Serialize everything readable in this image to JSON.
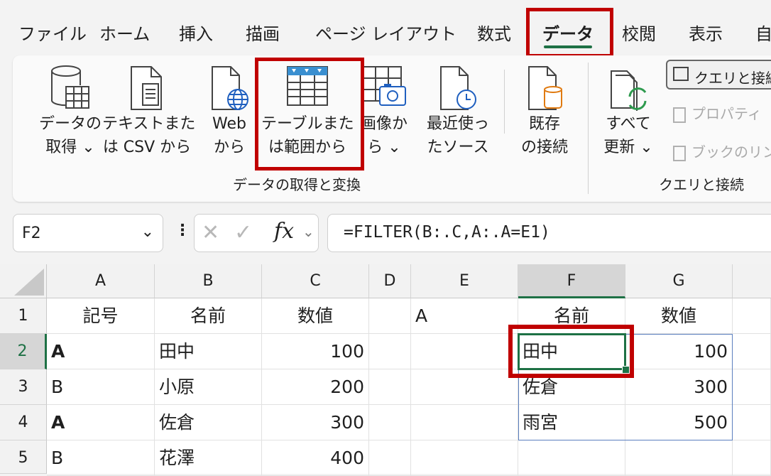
{
  "tabs": [
    "ファイル",
    "ホーム",
    "挿入",
    "描画",
    "ページ レイアウト",
    "数式",
    "データ",
    "校閲",
    "表示",
    "自"
  ],
  "active_tab": "データ",
  "ribbon": {
    "get_data": {
      "l1": "データの",
      "l2": "取得 ⌄"
    },
    "text_csv": {
      "l1": "テキストまた",
      "l2": "は CSV から"
    },
    "web": {
      "l1": "Web",
      "l2": "から"
    },
    "table_range": {
      "l1": "テーブルまた",
      "l2": "は範囲から"
    },
    "image": {
      "l1": "画像か",
      "l2": "ら ⌄"
    },
    "recent": {
      "l1": "最近使っ",
      "l2": "たソース"
    },
    "existing": {
      "l1": "既存",
      "l2": "の接続"
    },
    "group1_label": "データの取得と変換",
    "refresh_all": {
      "l1": "すべて",
      "l2": "更新 ⌄"
    },
    "queries": "クエリと接続",
    "properties": "プロパティ",
    "workbook_links": "ブックのリン",
    "group2_label": "クエリと接続"
  },
  "formula_bar": {
    "name_box": "F2",
    "fx": "fx",
    "formula": "=FILTER(B:.C,A:.A=E1)"
  },
  "sheet": {
    "columns": [
      "A",
      "B",
      "C",
      "D",
      "E",
      "F",
      "G"
    ],
    "selected_column": "F",
    "selected_row": "2",
    "rows": [
      {
        "n": "1",
        "A": "記号",
        "B": "名前",
        "C": "数値",
        "D": "",
        "E": "A",
        "F": "名前",
        "G": "数値"
      },
      {
        "n": "2",
        "A": "A",
        "B": "田中",
        "C": "100",
        "D": "",
        "E": "",
        "F": "田中",
        "G": "100"
      },
      {
        "n": "3",
        "A": "B",
        "B": "小原",
        "C": "200",
        "D": "",
        "E": "",
        "F": "佐倉",
        "G": "300"
      },
      {
        "n": "4",
        "A": "A",
        "B": "佐倉",
        "C": "300",
        "D": "",
        "E": "",
        "F": "雨宮",
        "G": "500"
      },
      {
        "n": "5",
        "A": "B",
        "B": "花澤",
        "C": "400",
        "D": "",
        "E": "",
        "F": "",
        "G": ""
      }
    ]
  },
  "colors": {
    "accent": "#1e7145",
    "highlight_box": "#c00000",
    "spill_border": "#5b7fbf"
  }
}
